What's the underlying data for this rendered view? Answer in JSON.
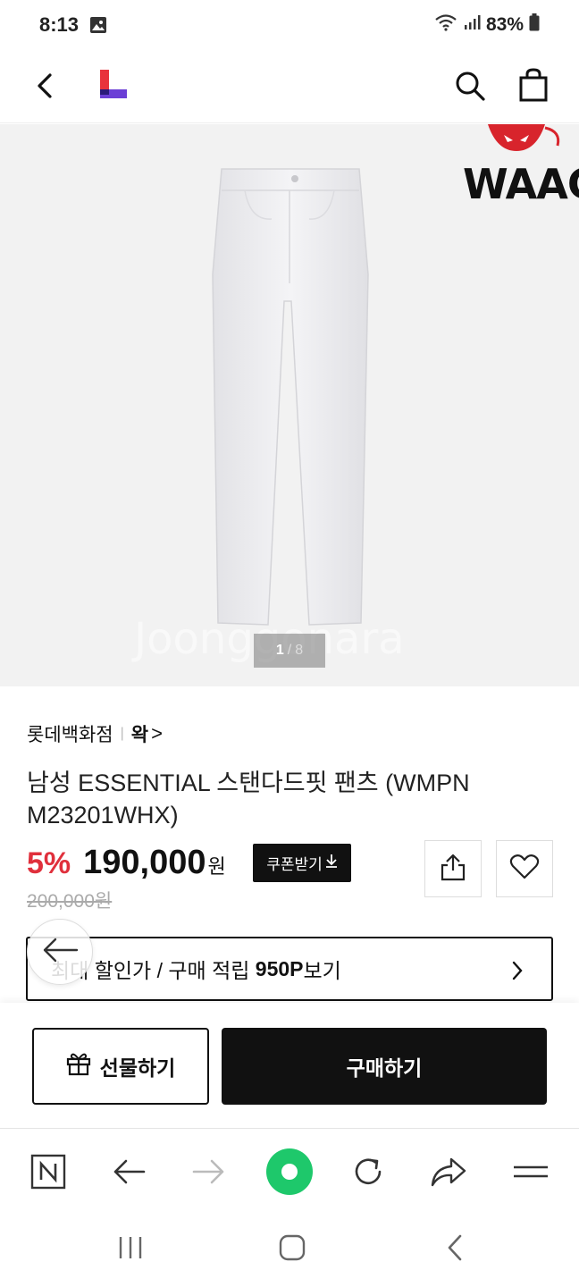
{
  "status_bar": {
    "time": "8:13",
    "battery": "83%"
  },
  "header": {
    "logo": "L",
    "icons": [
      "back-icon",
      "search-icon",
      "shopping-bag-icon"
    ]
  },
  "gallery": {
    "brand_logo": "WAAC",
    "current": "1",
    "separator": "/",
    "total": "8",
    "watermark": "Joonggonara"
  },
  "product": {
    "store": "롯데백화점",
    "brand": "왁",
    "brand_chevron": ">",
    "title": "남성 ESSENTIAL 스탠다드핏 팬츠 (WMPN M23201WHX)",
    "discount": "5%",
    "price": "190,000",
    "currency": "원",
    "original_price": "200,000원",
    "coupon_label": "쿠폰받기"
  },
  "benefit": {
    "prefix": "최대 할인가 / 구매 적립 ",
    "points": "950P",
    "suffix": "보기"
  },
  "actions": {
    "gift_label": "선물하기",
    "buy_label": "구매하기"
  },
  "colors": {
    "discount": "#e0303c",
    "primary": "#111111",
    "logo_red": "#e8323c",
    "logo_purple": "#6b3fd6",
    "browser_green": "#1ec86b"
  }
}
